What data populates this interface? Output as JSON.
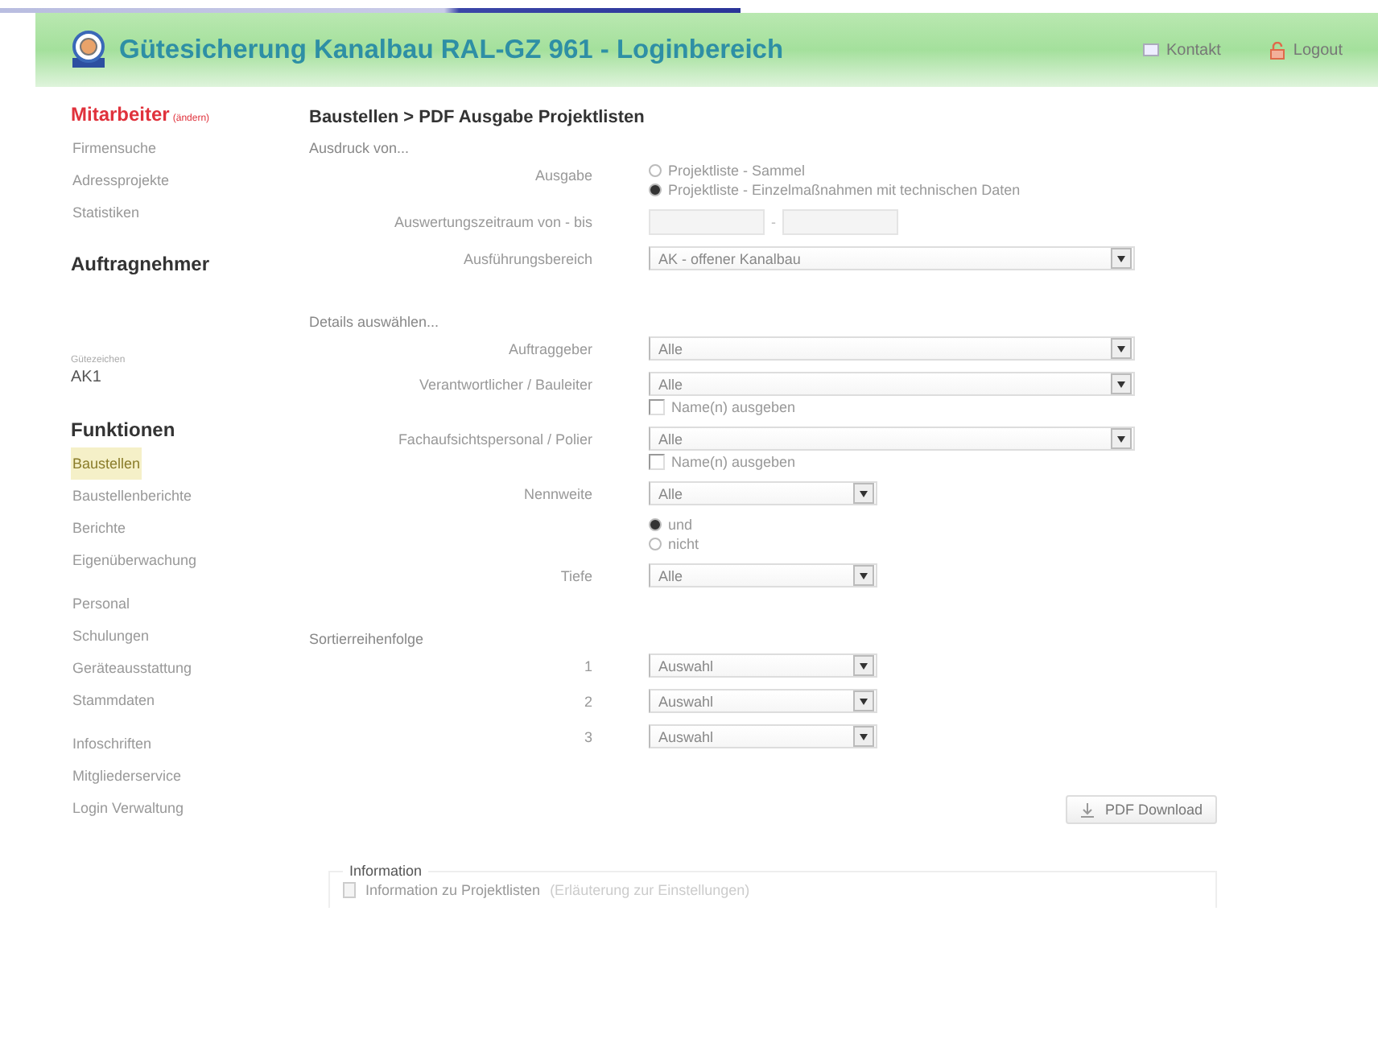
{
  "header": {
    "title": "Gütesicherung Kanalbau RAL-GZ 961 - Loginbereich",
    "links": [
      {
        "label": "Kontakt",
        "kind": "contact"
      },
      {
        "label": "Logout",
        "kind": "logout"
      }
    ]
  },
  "sidebar": {
    "user": {
      "label": "Mitarbeiter",
      "note": "(ändern)"
    },
    "user_items": [
      {
        "label": "Firmensuche",
        "selected": false
      },
      {
        "label": "Adressprojekte",
        "selected": false
      },
      {
        "label": "Statistiken",
        "selected": false
      }
    ],
    "contractor": {
      "title": "Auftragnehmer",
      "caption": "Gütezeichen",
      "value": "AK1"
    },
    "functions_title": "Funktionen",
    "function_groups": [
      [
        {
          "label": "Baustellen",
          "selected": true
        },
        {
          "label": "Baustellenberichte",
          "selected": false
        },
        {
          "label": "Berichte",
          "selected": false
        },
        {
          "label": "Eigenüberwachung",
          "selected": false
        }
      ],
      [
        {
          "label": "Personal",
          "selected": false
        },
        {
          "label": "Schulungen",
          "selected": false
        },
        {
          "label": "Geräteausstattung",
          "selected": false
        },
        {
          "label": "Stammdaten",
          "selected": false
        }
      ],
      [
        {
          "label": "Infoschriften",
          "selected": false
        },
        {
          "label": "Mitgliederservice",
          "selected": false
        },
        {
          "label": "Login Verwaltung",
          "selected": false
        }
      ]
    ]
  },
  "main": {
    "breadcrumb": "Baustellen > PDF Ausgabe Projektlisten",
    "sections": [
      {
        "title": "Ausdruck von...",
        "rows": [
          {
            "kind": "radio",
            "label": "Ausgabe",
            "options": [
              {
                "label": "Projektliste - Sammel",
                "selected": false
              },
              {
                "label": "Projektliste - Einzelmaßnahmen mit technischen Daten",
                "selected": true
              }
            ]
          },
          {
            "kind": "daterange",
            "label": "Auswertungszeitraum von - bis",
            "separator": "-"
          },
          {
            "kind": "select_wide",
            "label": "Ausführungsbereich",
            "value": "AK - offener Kanalbau"
          }
        ]
      },
      {
        "title": "Details auswählen...",
        "rows": [
          {
            "kind": "select_wide",
            "label": "Auftraggeber",
            "value": "Alle"
          },
          {
            "kind": "select_wide",
            "label": "Verantwortlicher / Bauleiter",
            "value": "Alle",
            "checkbox": {
              "label": "Name(n) ausgeben",
              "checked": false
            }
          },
          {
            "kind": "select_wide",
            "label": "Fachaufsichtspersonal / Polier",
            "value": "Alle",
            "checkbox": {
              "label": "Name(n) ausgeben",
              "checked": false
            }
          },
          {
            "kind": "select_narrow",
            "label": "Nennweite",
            "value": "Alle"
          },
          {
            "kind": "radio",
            "options": [
              {
                "label": "und",
                "selected": true
              },
              {
                "label": "nicht",
                "selected": false
              }
            ]
          },
          {
            "kind": "select_narrow",
            "label": "Tiefe",
            "value": "Alle"
          }
        ]
      },
      {
        "title": "Sortierreihenfolge",
        "rows": [
          {
            "kind": "select_narrow",
            "label": "1",
            "value": "Auswahl"
          },
          {
            "kind": "select_narrow",
            "label": "2",
            "value": "Auswahl"
          },
          {
            "kind": "select_narrow",
            "label": "3",
            "value": "Auswahl"
          }
        ]
      }
    ],
    "download_button": "PDF Download",
    "info": {
      "legend": "Information",
      "link": "Information zu Projektlisten",
      "note": "(Erläuterung zur Einstellungen)"
    }
  }
}
